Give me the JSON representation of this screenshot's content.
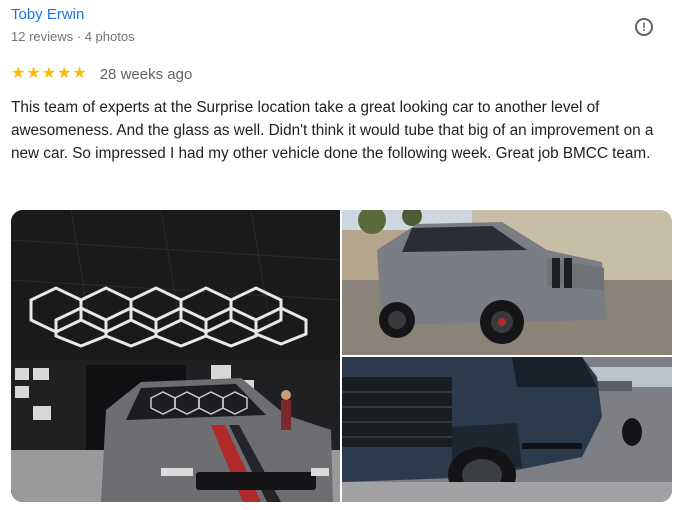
{
  "review": {
    "author": "Toby Erwin",
    "meta": "12 reviews · 4 photos",
    "rating": 5,
    "time_ago": "28 weeks ago",
    "text": "This team of experts at the Surprise location take a great looking car to another level of awesomeness. And the glass as well. Didn't think it would tube that big of an improvement on a new car. So impressed I had my other vehicle done the following week. Great job BMCC team.",
    "flag_icon": "flag-icon",
    "star_color": "#fbbc04",
    "author_color": "#1a73e8"
  },
  "photos": [
    {
      "subject": "gray Dodge Durango with red stripes under hexagonal garage lights"
    },
    {
      "subject": "gray Dodge Durango parked outside"
    },
    {
      "subject": "dark blue Ford pickup truck close-up"
    }
  ]
}
